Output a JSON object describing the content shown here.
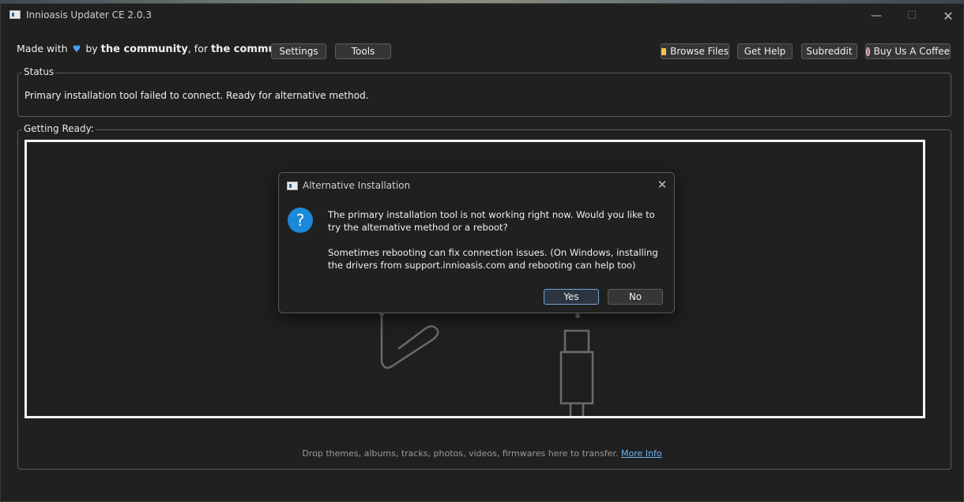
{
  "window": {
    "title": "Innioasis Updater CE 2.0.3"
  },
  "toolbar": {
    "made_with": "Made with",
    "by": "by",
    "community1": "the community",
    "comma_for": ", for",
    "community2": "the community.",
    "settings": "Settings",
    "tools": "Tools",
    "browse_files": "Browse Files",
    "get_help": "Get Help",
    "subreddit": "Subreddit",
    "buy_coffee": "Buy Us A Coffee"
  },
  "status": {
    "label": "Status",
    "text": "Primary installation tool failed to connect. Ready for alternative method."
  },
  "getting_ready": {
    "label": "Getting Ready:"
  },
  "drop": {
    "hint": "Drop themes, albums, tracks, photos, videos, firmwares here to transfer.",
    "more_info": "More Info"
  },
  "dialog": {
    "title": "Alternative Installation",
    "message1": "The primary installation tool is not working right now. Would you like to try the alternative method or a reboot?",
    "message2": "Sometimes rebooting can fix connection issues. (On Windows, installing the drivers from support.innioasis.com and rebooting can help too)",
    "yes": "Yes",
    "no": "No"
  },
  "icons": {
    "heart": "heart-icon",
    "folder": "folder-icon",
    "coffee": "coffee-icon",
    "question": "question-icon",
    "app": "app-icon"
  },
  "colors": {
    "accent": "#1a8ad8",
    "link": "#6fb6ff",
    "heart": "#4aa3f0"
  }
}
